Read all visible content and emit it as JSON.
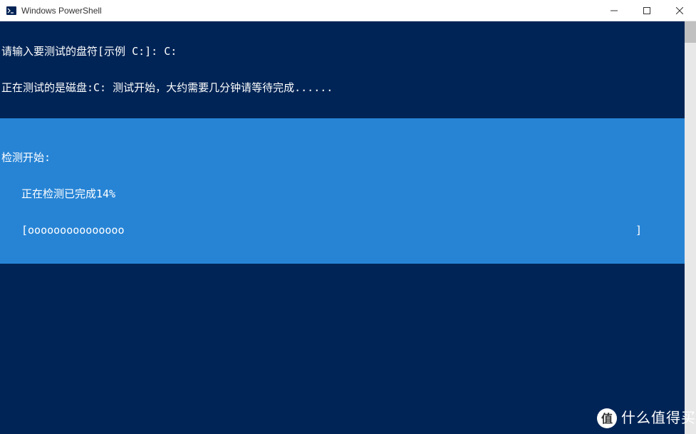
{
  "window": {
    "title": "Windows PowerShell"
  },
  "console": {
    "line1": "请输入要测试的盘符[示例 C:]: C:",
    "line2": "正在测试的是磁盘:C: 测试开始，大约需要几分钟请等待完成......",
    "highlight": {
      "header": "检测开始:",
      "status": "正在检测已完成14%",
      "progress_open": "[",
      "progress_fill": "ooooooooooooooo",
      "progress_close": "]"
    }
  },
  "watermark": {
    "badge": "值",
    "text": "什么值得买"
  }
}
